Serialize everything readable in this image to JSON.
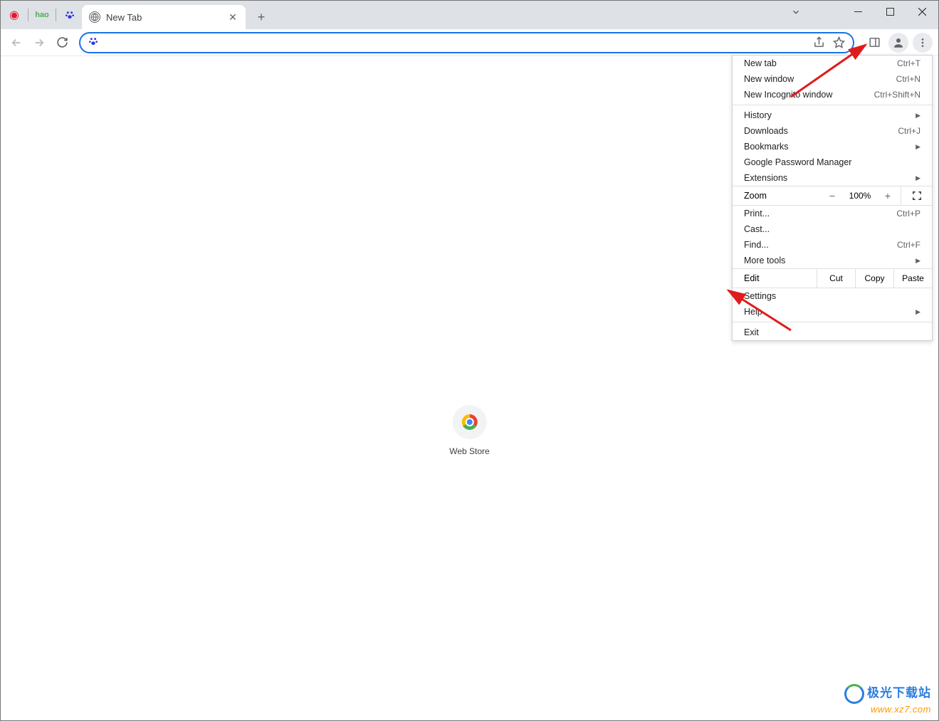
{
  "titlebar": {
    "tab_title": "New Tab",
    "icons": [
      "weibo",
      "hao",
      "paw"
    ]
  },
  "toolbar": {
    "omnibox_value": "",
    "omnibox_placeholder": ""
  },
  "content": {
    "shortcut_label": "Web Store"
  },
  "menu": {
    "new_tab": {
      "label": "New tab",
      "shortcut": "Ctrl+T"
    },
    "new_window": {
      "label": "New window",
      "shortcut": "Ctrl+N"
    },
    "new_incognito": {
      "label": "New Incognito window",
      "shortcut": "Ctrl+Shift+N"
    },
    "history": {
      "label": "History"
    },
    "downloads": {
      "label": "Downloads",
      "shortcut": "Ctrl+J"
    },
    "bookmarks": {
      "label": "Bookmarks"
    },
    "password_manager": {
      "label": "Google Password Manager"
    },
    "extensions": {
      "label": "Extensions"
    },
    "zoom": {
      "label": "Zoom",
      "value": "100%"
    },
    "print": {
      "label": "Print...",
      "shortcut": "Ctrl+P"
    },
    "cast": {
      "label": "Cast..."
    },
    "find": {
      "label": "Find...",
      "shortcut": "Ctrl+F"
    },
    "more_tools": {
      "label": "More tools"
    },
    "edit": {
      "label": "Edit",
      "cut": "Cut",
      "copy": "Copy",
      "paste": "Paste"
    },
    "settings": {
      "label": "Settings"
    },
    "help": {
      "label": "Help"
    },
    "exit": {
      "label": "Exit"
    }
  },
  "watermark": {
    "brand": "极光下载站",
    "url": "www.xz7.com"
  }
}
